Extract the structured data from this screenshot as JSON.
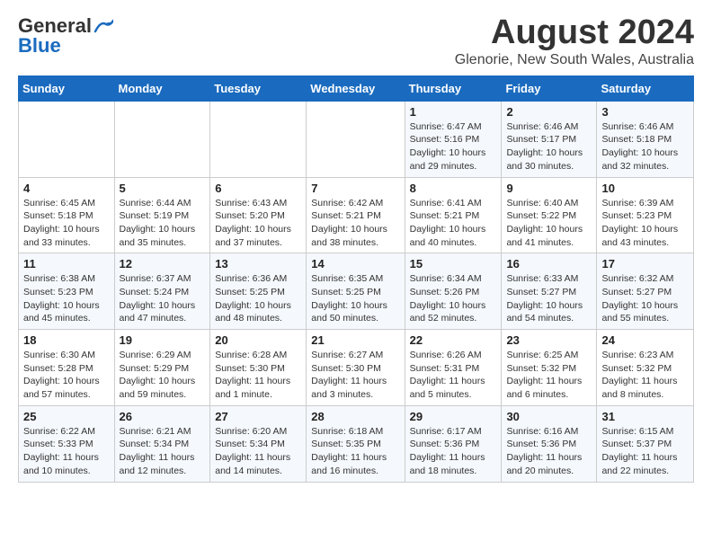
{
  "logo": {
    "general": "General",
    "blue": "Blue"
  },
  "title": "August 2024",
  "subtitle": "Glenorie, New South Wales, Australia",
  "days_of_week": [
    "Sunday",
    "Monday",
    "Tuesday",
    "Wednesday",
    "Thursday",
    "Friday",
    "Saturday"
  ],
  "weeks": [
    [
      {
        "day": "",
        "info": ""
      },
      {
        "day": "",
        "info": ""
      },
      {
        "day": "",
        "info": ""
      },
      {
        "day": "",
        "info": ""
      },
      {
        "day": "1",
        "info": "Sunrise: 6:47 AM\nSunset: 5:16 PM\nDaylight: 10 hours\nand 29 minutes."
      },
      {
        "day": "2",
        "info": "Sunrise: 6:46 AM\nSunset: 5:17 PM\nDaylight: 10 hours\nand 30 minutes."
      },
      {
        "day": "3",
        "info": "Sunrise: 6:46 AM\nSunset: 5:18 PM\nDaylight: 10 hours\nand 32 minutes."
      }
    ],
    [
      {
        "day": "4",
        "info": "Sunrise: 6:45 AM\nSunset: 5:18 PM\nDaylight: 10 hours\nand 33 minutes."
      },
      {
        "day": "5",
        "info": "Sunrise: 6:44 AM\nSunset: 5:19 PM\nDaylight: 10 hours\nand 35 minutes."
      },
      {
        "day": "6",
        "info": "Sunrise: 6:43 AM\nSunset: 5:20 PM\nDaylight: 10 hours\nand 37 minutes."
      },
      {
        "day": "7",
        "info": "Sunrise: 6:42 AM\nSunset: 5:21 PM\nDaylight: 10 hours\nand 38 minutes."
      },
      {
        "day": "8",
        "info": "Sunrise: 6:41 AM\nSunset: 5:21 PM\nDaylight: 10 hours\nand 40 minutes."
      },
      {
        "day": "9",
        "info": "Sunrise: 6:40 AM\nSunset: 5:22 PM\nDaylight: 10 hours\nand 41 minutes."
      },
      {
        "day": "10",
        "info": "Sunrise: 6:39 AM\nSunset: 5:23 PM\nDaylight: 10 hours\nand 43 minutes."
      }
    ],
    [
      {
        "day": "11",
        "info": "Sunrise: 6:38 AM\nSunset: 5:23 PM\nDaylight: 10 hours\nand 45 minutes."
      },
      {
        "day": "12",
        "info": "Sunrise: 6:37 AM\nSunset: 5:24 PM\nDaylight: 10 hours\nand 47 minutes."
      },
      {
        "day": "13",
        "info": "Sunrise: 6:36 AM\nSunset: 5:25 PM\nDaylight: 10 hours\nand 48 minutes."
      },
      {
        "day": "14",
        "info": "Sunrise: 6:35 AM\nSunset: 5:25 PM\nDaylight: 10 hours\nand 50 minutes."
      },
      {
        "day": "15",
        "info": "Sunrise: 6:34 AM\nSunset: 5:26 PM\nDaylight: 10 hours\nand 52 minutes."
      },
      {
        "day": "16",
        "info": "Sunrise: 6:33 AM\nSunset: 5:27 PM\nDaylight: 10 hours\nand 54 minutes."
      },
      {
        "day": "17",
        "info": "Sunrise: 6:32 AM\nSunset: 5:27 PM\nDaylight: 10 hours\nand 55 minutes."
      }
    ],
    [
      {
        "day": "18",
        "info": "Sunrise: 6:30 AM\nSunset: 5:28 PM\nDaylight: 10 hours\nand 57 minutes."
      },
      {
        "day": "19",
        "info": "Sunrise: 6:29 AM\nSunset: 5:29 PM\nDaylight: 10 hours\nand 59 minutes."
      },
      {
        "day": "20",
        "info": "Sunrise: 6:28 AM\nSunset: 5:30 PM\nDaylight: 11 hours\nand 1 minute."
      },
      {
        "day": "21",
        "info": "Sunrise: 6:27 AM\nSunset: 5:30 PM\nDaylight: 11 hours\nand 3 minutes."
      },
      {
        "day": "22",
        "info": "Sunrise: 6:26 AM\nSunset: 5:31 PM\nDaylight: 11 hours\nand 5 minutes."
      },
      {
        "day": "23",
        "info": "Sunrise: 6:25 AM\nSunset: 5:32 PM\nDaylight: 11 hours\nand 6 minutes."
      },
      {
        "day": "24",
        "info": "Sunrise: 6:23 AM\nSunset: 5:32 PM\nDaylight: 11 hours\nand 8 minutes."
      }
    ],
    [
      {
        "day": "25",
        "info": "Sunrise: 6:22 AM\nSunset: 5:33 PM\nDaylight: 11 hours\nand 10 minutes."
      },
      {
        "day": "26",
        "info": "Sunrise: 6:21 AM\nSunset: 5:34 PM\nDaylight: 11 hours\nand 12 minutes."
      },
      {
        "day": "27",
        "info": "Sunrise: 6:20 AM\nSunset: 5:34 PM\nDaylight: 11 hours\nand 14 minutes."
      },
      {
        "day": "28",
        "info": "Sunrise: 6:18 AM\nSunset: 5:35 PM\nDaylight: 11 hours\nand 16 minutes."
      },
      {
        "day": "29",
        "info": "Sunrise: 6:17 AM\nSunset: 5:36 PM\nDaylight: 11 hours\nand 18 minutes."
      },
      {
        "day": "30",
        "info": "Sunrise: 6:16 AM\nSunset: 5:36 PM\nDaylight: 11 hours\nand 20 minutes."
      },
      {
        "day": "31",
        "info": "Sunrise: 6:15 AM\nSunset: 5:37 PM\nDaylight: 11 hours\nand 22 minutes."
      }
    ]
  ]
}
